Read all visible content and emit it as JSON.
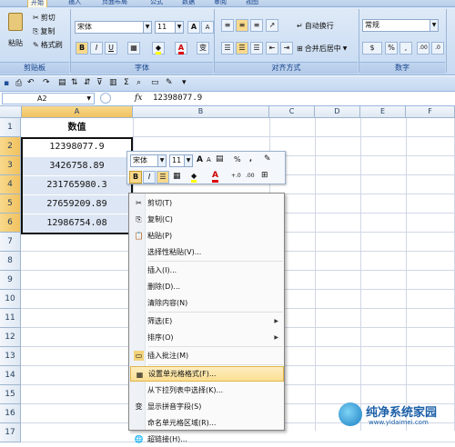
{
  "ribbon": {
    "tabs": [
      "开始",
      "插入",
      "页面布局",
      "公式",
      "数据",
      "审阅",
      "视图"
    ],
    "clipboard": {
      "paste": "粘贴",
      "cut": "剪切",
      "copy": "复制",
      "format_painter": "格式刷",
      "label": "剪贴板"
    },
    "font": {
      "name": "宋体",
      "size": "11",
      "grow": "A",
      "shrink": "A",
      "bold": "B",
      "italic": "I",
      "underline": "U",
      "phonetic": "变",
      "label": "字体"
    },
    "alignment": {
      "wrap": "自动换行",
      "merge": "合并后居中",
      "label": "对齐方式"
    },
    "number": {
      "format": "常规",
      "percent": "%",
      "comma": ",",
      "inc_decimal": ".00",
      "dec_decimal": ".0",
      "label": "数字"
    }
  },
  "formula_bar": {
    "cell_ref": "A2",
    "fx": "fx",
    "content": "12398077.9"
  },
  "grid": {
    "columns": [
      "A",
      "B",
      "C",
      "D",
      "E",
      "F"
    ],
    "rows": [
      "1",
      "2",
      "3",
      "4",
      "5",
      "6",
      "7",
      "8",
      "9",
      "10",
      "11",
      "12",
      "13",
      "14",
      "15",
      "16",
      "17"
    ],
    "header": "数值",
    "values": [
      "12398077.9",
      "3426758.89",
      "231765980.3",
      "27659209.89",
      "12986754.08"
    ]
  },
  "mini_toolbar": {
    "font": "宋体",
    "size": "11",
    "grow": "A",
    "shrink": "A",
    "percent": "%",
    "comma": ",",
    "bold": "B",
    "italic": "I",
    "inc_decimal": "+.0",
    "dec_decimal": ".00"
  },
  "context_menu": {
    "items": [
      {
        "label": "剪切(T)",
        "icon": "scissors-icon",
        "glyph": "✂"
      },
      {
        "label": "复制(C)",
        "icon": "copy-icon",
        "glyph": "⎘"
      },
      {
        "label": "粘贴(P)",
        "icon": "paste-icon",
        "glyph": "📋"
      },
      {
        "label": "选择性粘贴(V)...",
        "icon": "",
        "glyph": ""
      },
      {
        "label": "插入(I)...",
        "icon": "",
        "glyph": ""
      },
      {
        "label": "删除(D)...",
        "icon": "",
        "glyph": ""
      },
      {
        "label": "清除内容(N)",
        "icon": "",
        "glyph": ""
      },
      {
        "label": "筛选(E)",
        "icon": "",
        "glyph": "",
        "submenu": "▶"
      },
      {
        "label": "排序(O)",
        "icon": "",
        "glyph": "",
        "submenu": "▶"
      },
      {
        "label": "插入批注(M)",
        "icon": "comment-icon",
        "glyph": "▭"
      },
      {
        "label": "设置单元格格式(F)...",
        "icon": "format-cells-icon",
        "glyph": "▦"
      },
      {
        "label": "从下拉列表中选择(K)...",
        "icon": "",
        "glyph": ""
      },
      {
        "label": "显示拼音字段(S)",
        "icon": "phonetic-icon",
        "glyph": "变"
      },
      {
        "label": "命名单元格区域(R)...",
        "icon": "",
        "glyph": ""
      },
      {
        "label": "超链接(H)...",
        "icon": "hyperlink-icon",
        "glyph": "🌐"
      }
    ]
  },
  "watermark": {
    "title": "纯净系统家园",
    "url": "www.yidaimei.com"
  },
  "colors": {
    "selection": "#dde6f4",
    "highlight": "#fbdf92",
    "ribbon": "#c6daf2"
  }
}
